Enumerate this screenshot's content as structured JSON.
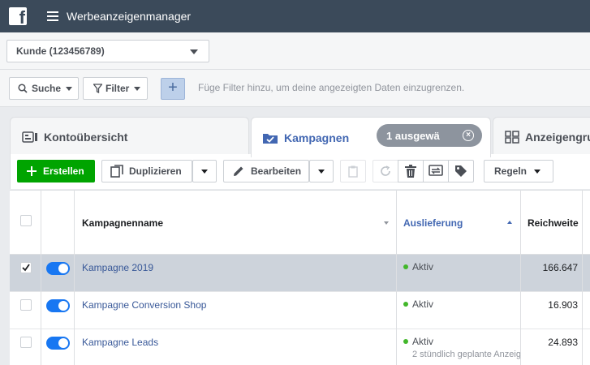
{
  "topbar": {
    "logo_letter": "f",
    "app_title": "Werbeanzeigenmanager"
  },
  "account": {
    "selected": "Kunde (123456789)"
  },
  "filters": {
    "search_label": "Suche",
    "filter_label": "Filter",
    "add_symbol": "+",
    "hint": "Füge Filter hinzu, um deine angezeigten Daten einzugrenzen."
  },
  "tabs": [
    {
      "label": "Kontoübersicht"
    },
    {
      "label": "Kampagnen"
    },
    {
      "label": "Anzeigengru"
    }
  ],
  "selection_badge": {
    "label": "1 ausgewä",
    "close": "×"
  },
  "toolbar": {
    "create_label": "Erstellen",
    "duplicate_label": "Duplizieren",
    "edit_label": "Bearbeiten",
    "rules_label": "Regeln"
  },
  "table": {
    "columns": {
      "name": "Kampagnenname",
      "delivery": "Auslieferung",
      "reach": "Reichweite"
    },
    "rows": [
      {
        "name": "Kampagne 2019",
        "status": "Aktiv",
        "status_sub": "",
        "reach": "166.647",
        "checked": true
      },
      {
        "name": "Kampagne Conversion Shop",
        "status": "Aktiv",
        "status_sub": "",
        "reach": "16.903",
        "checked": false
      },
      {
        "name": "Kampagne Leads",
        "status": "Aktiv",
        "status_sub": "2 stündlich geplante Anzeig",
        "reach": "24.893",
        "checked": false
      }
    ]
  },
  "colors": {
    "topbar": "#3b4a5a",
    "active_tab": "#4267b2",
    "create_button": "#00a400",
    "toggle_on": "#1877f2",
    "status_active": "#42b72a",
    "selected_row": "#cdd3db"
  }
}
